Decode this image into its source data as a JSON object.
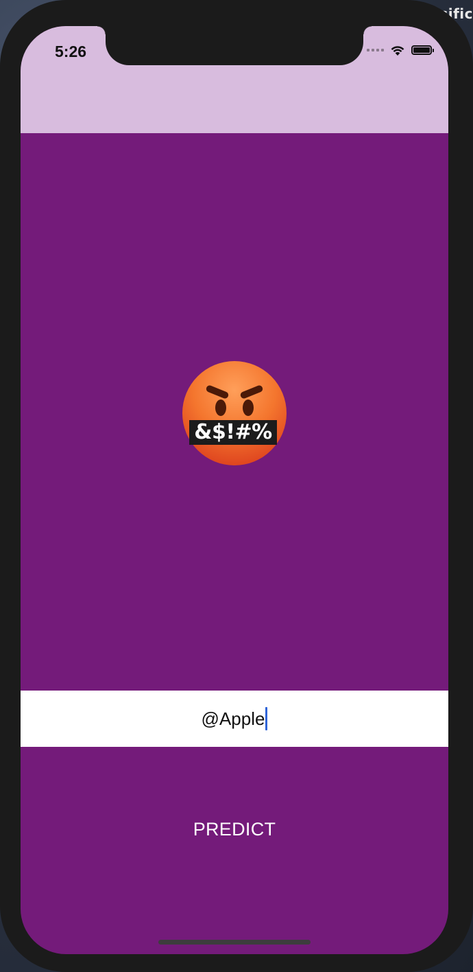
{
  "desktop": {
    "corner_text": "sific"
  },
  "status_bar": {
    "time": "5:26",
    "icons": [
      "cellular-signal-icon",
      "wifi-icon",
      "battery-icon"
    ]
  },
  "prediction": {
    "emoji_name": "face-with-symbols-on-mouth-icon",
    "emoji_symbols": "&$!#%"
  },
  "tweet_input": {
    "value": "@Apple"
  },
  "actions": {
    "predict_label": "PREDICT"
  },
  "colors": {
    "nav_bar": "#d8bcde",
    "background": "#741b7a",
    "input_background": "#ffffff",
    "caret": "#2f64d8",
    "button_text": "#ffffff"
  }
}
